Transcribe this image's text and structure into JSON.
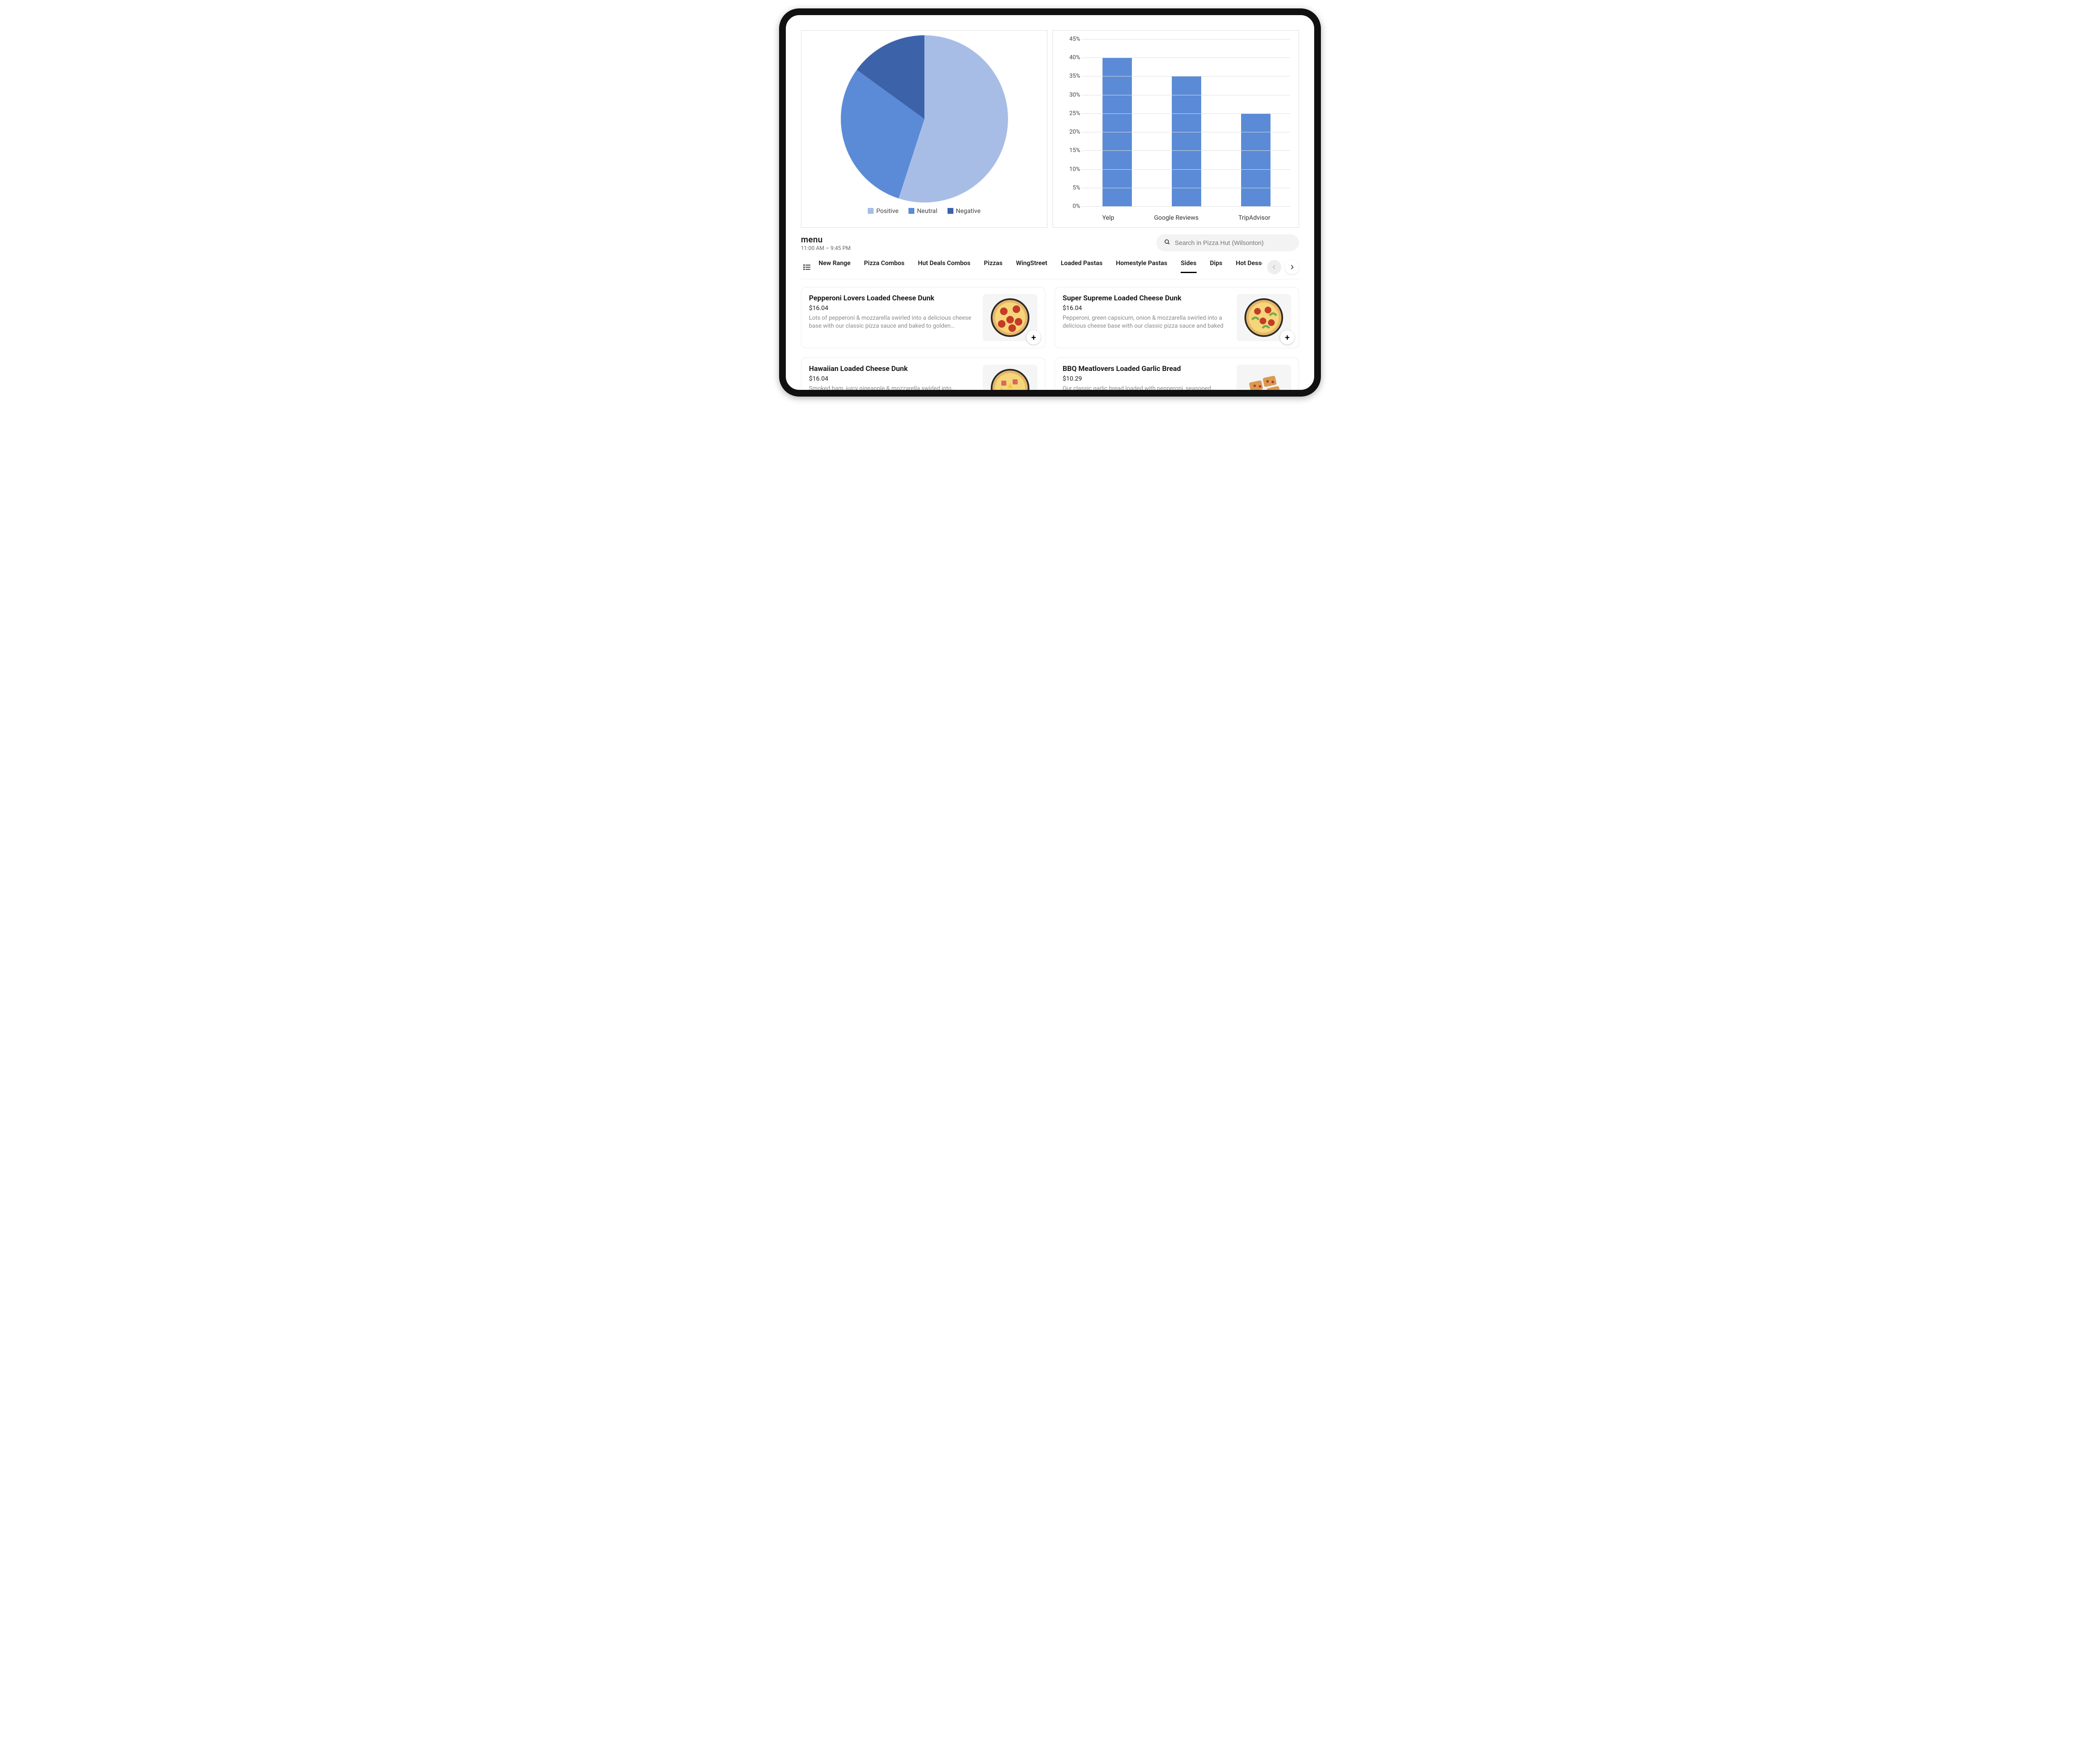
{
  "chart_data": [
    {
      "type": "pie",
      "series": [
        {
          "name": "Positive",
          "value": 55,
          "color": "#a8bde6"
        },
        {
          "name": "Neutral",
          "value": 30,
          "color": "#5b8bd6"
        },
        {
          "name": "Negative",
          "value": 15,
          "color": "#3c62aa"
        }
      ],
      "title": "",
      "legend_position": "bottom"
    },
    {
      "type": "bar",
      "categories": [
        "Yelp",
        "Google Reviews",
        "TripAdvisor"
      ],
      "values": [
        40,
        35,
        25
      ],
      "ylabel": "",
      "xlabel": "",
      "ylim": [
        0,
        45
      ],
      "ytick_step": 5,
      "y_suffix": "%",
      "bar_color": "#5b8bd6",
      "grid": true
    }
  ],
  "menu": {
    "title": "menu",
    "hours": "11:00 AM – 9:45 PM"
  },
  "search": {
    "placeholder": "Search in Pizza Hut (Wilsonton)"
  },
  "tabs": {
    "items": [
      "New Range",
      "Pizza Combos",
      "Hut Deals Combos",
      "Pizzas",
      "WingStreet",
      "Loaded Pastas",
      "Homestyle Pastas",
      "Sides",
      "Dips",
      "Hot Desserts"
    ],
    "active_index": 7
  },
  "items": [
    {
      "name": "Pepperoni Lovers Loaded Cheese Dunk",
      "price": "$16.04",
      "desc": "Lots of pepperoni & mozzarella swirled into a delicious cheese base with our classic pizza sauce and baked to golden…",
      "thumb": "pepperoni"
    },
    {
      "name": "Super Supreme Loaded Cheese Dunk",
      "price": "$16.04",
      "desc": "Pepperoni, green capsicum, onion & mozzarella swirled into a delicious cheese base with our classic pizza sauce and baked t…",
      "thumb": "supreme"
    },
    {
      "name": "Hawaiian Loaded Cheese Dunk",
      "price": "$16.04",
      "desc": "Smoked ham, juicy pineapple & mozzarella swirled into…",
      "thumb": "hawaiian"
    },
    {
      "name": "BBQ Meatlovers Loaded Garlic Bread",
      "price": "$10.29",
      "desc": "Our classic garlic bread loaded with pepperoni, seasoned…",
      "thumb": "bbq-bread"
    }
  ]
}
